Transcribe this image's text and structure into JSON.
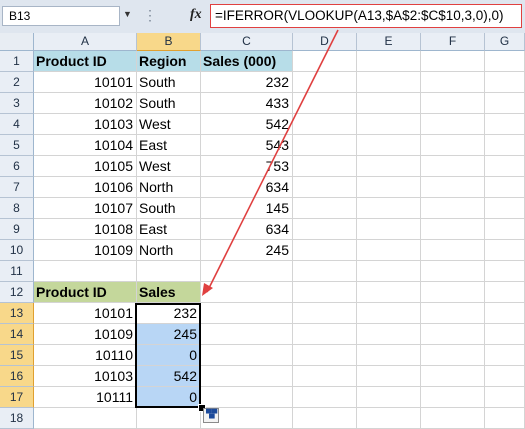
{
  "formula_bar": {
    "name_box": "B13",
    "fx_label": "fx",
    "formula": "=IFERROR(VLOOKUP(A13,$A$2:$C$10,3,0),0)"
  },
  "columns": [
    "A",
    "B",
    "C",
    "D",
    "E",
    "F",
    "G"
  ],
  "selected_column": "B",
  "rows": [
    "1",
    "2",
    "3",
    "4",
    "5",
    "6",
    "7",
    "8",
    "9",
    "10",
    "11",
    "12",
    "13",
    "14",
    "15",
    "16",
    "17",
    "18"
  ],
  "selected_rows": [
    "13",
    "14",
    "15",
    "16",
    "17"
  ],
  "sheet": {
    "row1": {
      "a": "Product ID",
      "b": "Region",
      "c": "Sales (000)"
    },
    "table1": [
      {
        "a": "10101",
        "b": "South",
        "c": "232"
      },
      {
        "a": "10102",
        "b": "South",
        "c": "433"
      },
      {
        "a": "10103",
        "b": "West",
        "c": "542"
      },
      {
        "a": "10104",
        "b": "East",
        "c": "543"
      },
      {
        "a": "10105",
        "b": "West",
        "c": "753"
      },
      {
        "a": "10106",
        "b": "North",
        "c": "634"
      },
      {
        "a": "10107",
        "b": "South",
        "c": "145"
      },
      {
        "a": "10108",
        "b": "East",
        "c": "634"
      },
      {
        "a": "10109",
        "b": "North",
        "c": "245"
      }
    ],
    "row12": {
      "a": "Product ID",
      "b": "Sales"
    },
    "table2": [
      {
        "a": "10101",
        "b": "232"
      },
      {
        "a": "10109",
        "b": "245"
      },
      {
        "a": "10110",
        "b": "0"
      },
      {
        "a": "10103",
        "b": "542"
      },
      {
        "a": "10111",
        "b": "0"
      }
    ]
  },
  "colors": {
    "header1_fill": "#b7dde8",
    "header2_fill": "#c4d79b",
    "selection_fill": "#b8d6f5",
    "annotation_red": "#e04040"
  }
}
